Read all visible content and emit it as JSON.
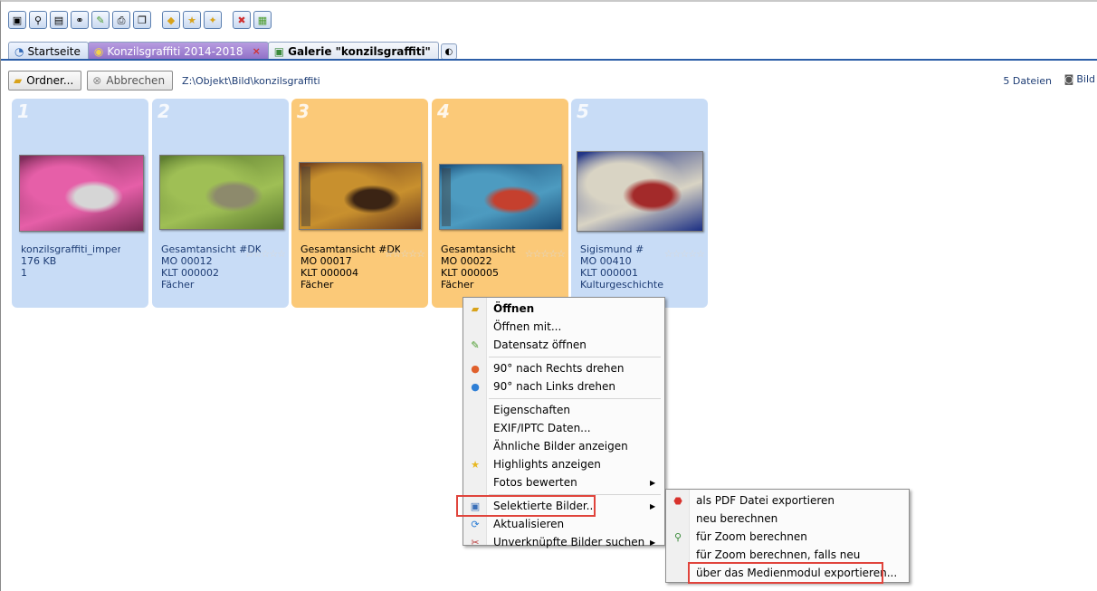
{
  "toolbar": {
    "icons": [
      "save-icon",
      "search-icon",
      "window-icon",
      "tree-icon",
      "edit-icon",
      "print-icon",
      "copy-icon",
      "folder-add-icon",
      "folder-star-icon",
      "folder-new-icon",
      "delete-icon",
      "gallery-icon"
    ]
  },
  "tabs": [
    {
      "label": "Startseite"
    },
    {
      "label": "Konzilsgraffiti 2014-2018",
      "close": "×"
    },
    {
      "label": "Galerie \"konzilsgraffiti\""
    }
  ],
  "pathbar": {
    "folder_label": "Ordner...",
    "cancel_label": "Abbrechen",
    "path": "Z:\\Objekt\\Bild\\konzilsgraffiti",
    "count": "5 Dateien",
    "view_label": "Bild"
  },
  "cards": [
    {
      "num": "1",
      "lines": [
        "konzilsgraffiti_imperia.jp",
        "176 KB",
        "1"
      ],
      "selected": false,
      "colors": [
        "#7a2a56",
        "#e65fa8",
        "#d6d6d6"
      ]
    },
    {
      "num": "2",
      "lines": [
        "Gesamtansicht #DK #D",
        "MO 00012",
        "KLT 000002",
        "Fächer"
      ],
      "selected": false,
      "colors": [
        "#5b7a2f",
        "#9fbf55",
        "#8d8a6c"
      ]
    },
    {
      "num": "3",
      "lines": [
        "Gesamtansicht #DK-",
        "MO 00017",
        "KLT 000004",
        "Fächer"
      ],
      "selected": true,
      "colors": [
        "#6b3a1c",
        "#c8902e",
        "#3b2414"
      ]
    },
    {
      "num": "4",
      "lines": [
        "Gesamtansicht",
        "MO 00022",
        "KLT 000005",
        "Fächer"
      ],
      "selected": true,
      "colors": [
        "#1b4f7a",
        "#4d9bc0",
        "#c5402e"
      ]
    },
    {
      "num": "5",
      "lines": [
        "Sigismund #",
        "MO 00410",
        "KLT 000001",
        "Kulturgeschichte"
      ],
      "selected": false,
      "colors": [
        "#1b2f84",
        "#d9d4c4",
        "#a32a2a"
      ]
    }
  ],
  "stars": "☆☆☆☆☆",
  "context_menu": {
    "items": [
      {
        "label": "Öffnen",
        "icon": "folder-icon",
        "bold": true
      },
      {
        "label": "Öffnen mit..."
      },
      {
        "label": "Datensatz öffnen",
        "icon": "pencil-icon"
      },
      {
        "sep": true
      },
      {
        "label": "90° nach Rechts drehen",
        "icon": "rotate-right-icon"
      },
      {
        "label": "90° nach Links drehen",
        "icon": "rotate-left-icon"
      },
      {
        "sep": true
      },
      {
        "label": "Eigenschaften"
      },
      {
        "label": "EXIF/IPTC Daten..."
      },
      {
        "label": "Ähnliche Bilder anzeigen"
      },
      {
        "label": "Highlights anzeigen",
        "icon": "star-icon"
      },
      {
        "label": "Fotos bewerten",
        "arrow": true
      },
      {
        "sep": true
      },
      {
        "label": "Selektierte Bilder...",
        "icon": "images-icon",
        "arrow": true,
        "highlighted": true
      },
      {
        "label": "Aktualisieren",
        "icon": "refresh-icon"
      },
      {
        "label": "Unverknüpfte Bilder suchen",
        "icon": "unlink-icon",
        "arrow": true
      }
    ]
  },
  "submenu": {
    "items": [
      {
        "label": "als PDF Datei exportieren",
        "icon": "pdf-icon"
      },
      {
        "label": "neu berechnen"
      },
      {
        "label": "für Zoom berechnen",
        "icon": "zoom-icon"
      },
      {
        "label": "für Zoom berechnen, falls neu"
      },
      {
        "label": "über das Medienmodul exportieren...",
        "highlighted": true
      }
    ]
  },
  "colors": {
    "accent": "#2c5ea8",
    "card_default": "#c8dcf6",
    "card_selected": "#fbc978",
    "highlight_box": "#e0443c"
  }
}
